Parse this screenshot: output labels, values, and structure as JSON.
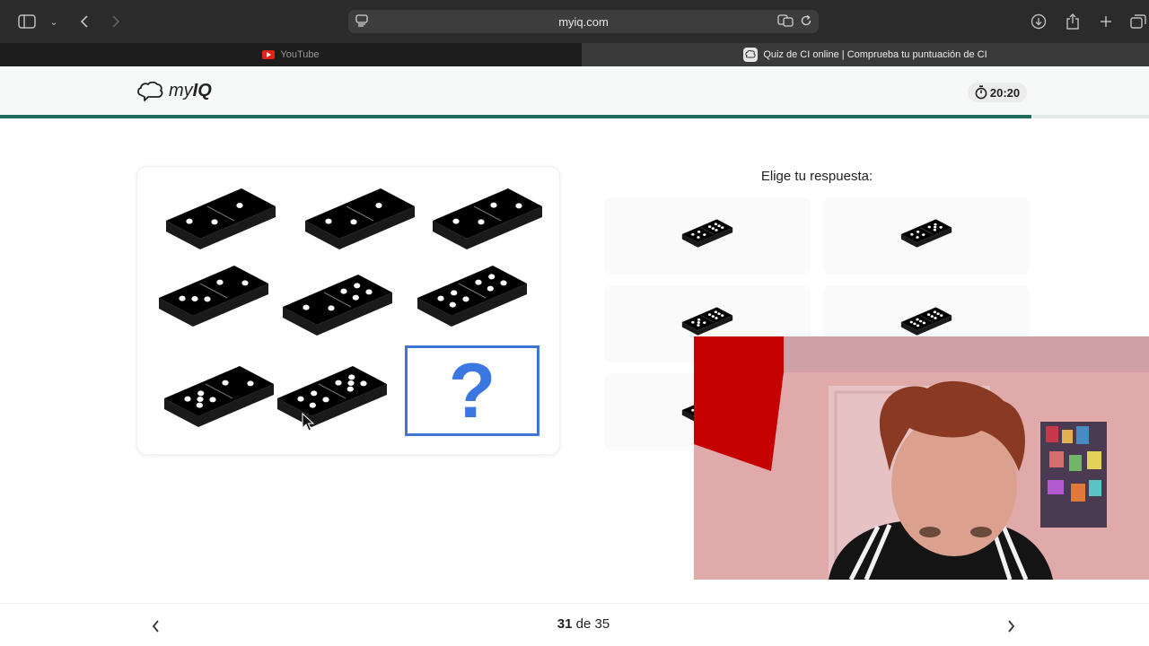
{
  "browser": {
    "url": "myiq.com",
    "tabs": [
      {
        "label": "YouTube",
        "active": false
      },
      {
        "label": "Quiz de CI online | Comprueba tu puntuación de CI",
        "active": true
      }
    ]
  },
  "site": {
    "logo_prefix": "my",
    "logo_suffix": "IQ",
    "timer": "20:20",
    "progress_fraction": 0.898,
    "accent_color": "#1f6b5c"
  },
  "puzzle": {
    "question_mark": "?",
    "missing_cell_color": "#3f76d6"
  },
  "answers": {
    "title": "Elige tu respuesta:",
    "options_count": 6
  },
  "footer": {
    "current": "31",
    "separator": "de",
    "total": "35"
  }
}
